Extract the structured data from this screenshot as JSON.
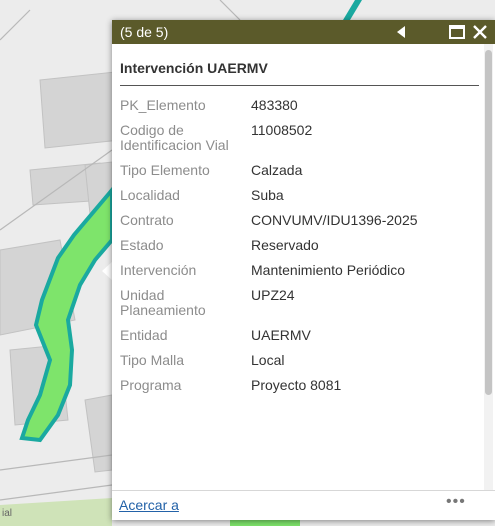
{
  "popup": {
    "counter": "(5 de 5)",
    "title": "Intervención UAERMV",
    "attributes": [
      {
        "label": "PK_Elemento",
        "value": "483380"
      },
      {
        "label": "Codigo de Identificacion Vial",
        "value": "11008502"
      },
      {
        "label": "Tipo Elemento",
        "value": "Calzada"
      },
      {
        "label": "Localidad",
        "value": "Suba"
      },
      {
        "label": "Contrato",
        "value": "CONVUMV/IDU1396-2025"
      },
      {
        "label": "Estado",
        "value": "Reservado"
      },
      {
        "label": "Intervención",
        "value": "Mantenimiento Periódico"
      },
      {
        "label": "Unidad Planeamiento",
        "value": "UPZ24"
      },
      {
        "label": "Entidad",
        "value": "UAERMV"
      },
      {
        "label": "Tipo Malla",
        "value": "Local"
      },
      {
        "label": "Programa",
        "value": "Proyecto 8081"
      }
    ],
    "footer": {
      "zoom_link": "Acercar a",
      "more_menu": "•••"
    }
  },
  "map": {
    "corner_label": "ial"
  },
  "icons": {
    "prev": "triangle-left-icon",
    "maximize": "maximize-icon",
    "close": "close-icon",
    "more": "ellipsis-icon"
  },
  "colors": {
    "header": "#5b5a2a",
    "link": "#2362a8",
    "road_fill": "#7ee46b",
    "road_edge": "#1aa9a0"
  }
}
